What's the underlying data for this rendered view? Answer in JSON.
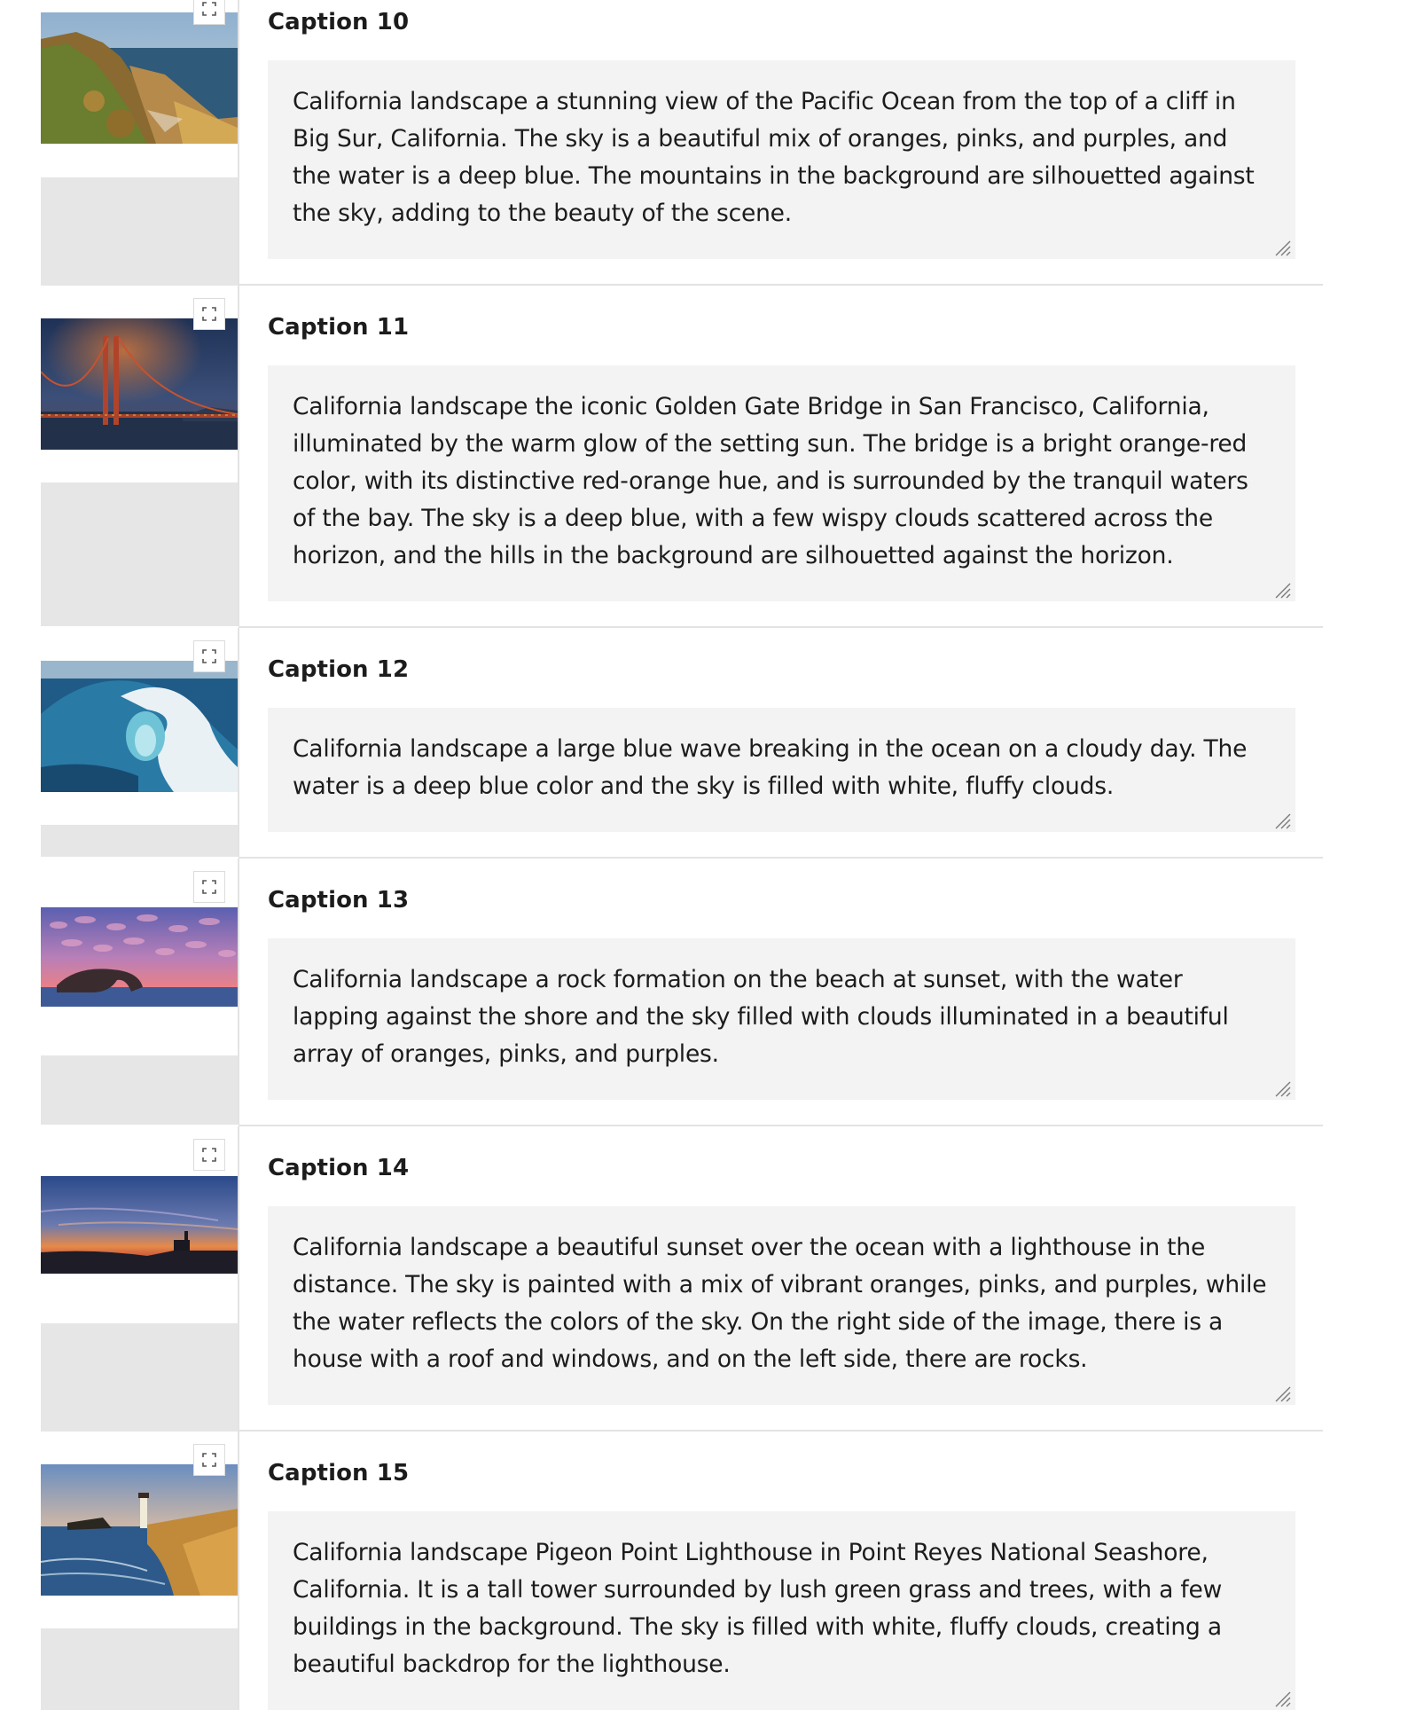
{
  "captions": [
    {
      "title": "Caption 10",
      "text": "California landscape a stunning view of the Pacific Ocean from the top of a cliff in Big Sur, California. The sky is a beautiful mix of oranges, pinks, and purples, and the water is a deep blue. The mountains in the background are silhouetted against the sky, adding to the beauty of the scene.",
      "thumb": "rocky-coast-cliffs-image"
    },
    {
      "title": "Caption 11",
      "text": "California landscape the iconic Golden Gate Bridge in San Francisco, California, illuminated by the warm glow of the setting sun. The bridge is a bright orange-red color, with its distinctive red-orange hue, and is surrounded by the tranquil waters of the bay. The sky is a deep blue, with a few wispy clouds scattered across the horizon, and the hills in the background are silhouetted against the horizon.",
      "thumb": "golden-gate-bridge-image"
    },
    {
      "title": "Caption 12",
      "text": "California landscape a large blue wave breaking in the ocean on a cloudy day. The water is a deep blue color and the sky is filled with white, fluffy clouds.",
      "thumb": "breaking-wave-image"
    },
    {
      "title": "Caption 13",
      "text": "California landscape a rock formation on the beach at sunset, with the water lapping against the shore and the sky filled with clouds illuminated in a beautiful array of oranges, pinks, and purples.",
      "thumb": "rock-arch-sunset-image"
    },
    {
      "title": "Caption 14",
      "text": "California landscape a beautiful sunset over the ocean with a lighthouse in the distance. The sky is painted with a mix of vibrant oranges, pinks, and purples, while the water reflects the colors of the sky. On the right side of the image, there is a house with a roof and windows, and on the left side, there are rocks.",
      "thumb": "ocean-sunset-lighthouse-image"
    },
    {
      "title": "Caption 15",
      "text": "California landscape Pigeon Point Lighthouse in Point Reyes National Seashore, California. It is a tall tower surrounded by lush green grass and trees, with a few buildings in the background. The sky is filled with white, fluffy clouds, creating a beautiful backdrop for the lighthouse.",
      "thumb": "pigeon-point-lighthouse-image"
    }
  ],
  "icons": {
    "expand": "expand-icon",
    "resize": "resize-grip-icon"
  }
}
